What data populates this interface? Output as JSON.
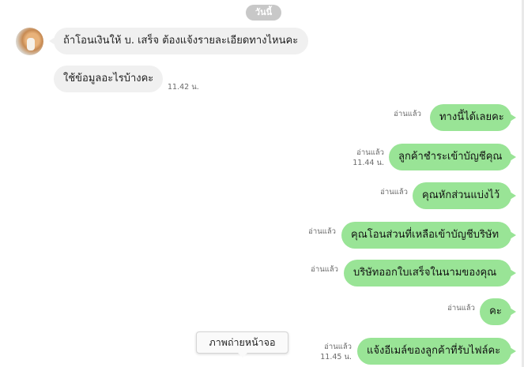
{
  "date_label": "วันนี้",
  "incoming": [
    {
      "text": "ถ้าโอนเงินให้ บ. เสร็จ ต้องแจ้งรายละเอียดทางไหนคะ",
      "time": ""
    },
    {
      "text": "ใช้ข้อมูลอะไรบ้างคะ",
      "time": "11.42 น."
    }
  ],
  "outgoing": [
    {
      "text": "ทางนี้ได้เลยคะ",
      "read": "อ่านแล้ว",
      "time": ""
    },
    {
      "text": "ลูกค้าชำระเข้าบัญชีคุณ",
      "read": "อ่านแล้ว",
      "time": "11.44 น."
    },
    {
      "text": "คุณหักส่วนแบ่งไว้",
      "read": "อ่านแล้ว",
      "time": ""
    },
    {
      "text": "คุณโอนส่วนที่เหลือเข้าบัญชีบริษัท",
      "read": "อ่านแล้ว",
      "time": ""
    },
    {
      "text": "บริษัทออกใบเสร็จในนามของคุณ",
      "read": "อ่านแล้ว",
      "time": ""
    },
    {
      "text": "คะ",
      "read": "อ่านแล้ว",
      "time": ""
    },
    {
      "text": "แจ้งอีเมล์ของลูกค้าที่รับไฟล์คะ",
      "read": "อ่านแล้ว",
      "time": "11.45 น."
    }
  ],
  "tooltip": "ภาพถ่ายหน้าจอ",
  "colors": {
    "outgoing_bubble": "#99e496",
    "incoming_bubble": "#f0f0f0",
    "date_pill": "#c8c8c8"
  }
}
